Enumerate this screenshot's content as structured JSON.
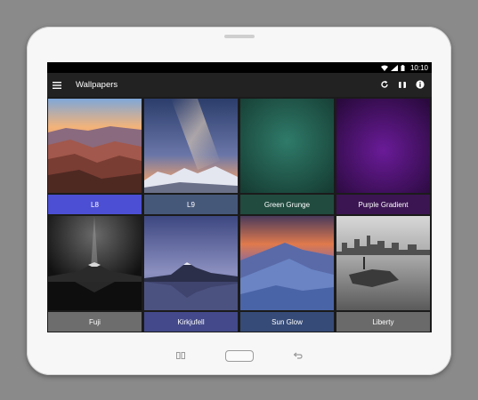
{
  "status": {
    "time": "10:10"
  },
  "appbar": {
    "title": "Wallpapers"
  },
  "wallpapers": [
    {
      "label": "L8",
      "label_color": "#4c4fd3"
    },
    {
      "label": "L9",
      "label_color": "#46587a"
    },
    {
      "label": "Green Grunge",
      "label_color": "#214b3f"
    },
    {
      "label": "Purple Gradient",
      "label_color": "#3b1552"
    },
    {
      "label": "Fuji",
      "label_color": "#6d6d6d"
    },
    {
      "label": "Kirkjufell",
      "label_color": "#43498a"
    },
    {
      "label": "Sun Glow",
      "label_color": "#364b78"
    },
    {
      "label": "Liberty",
      "label_color": "#6a6a6a"
    }
  ],
  "icons": {
    "menu": "hamburger-menu-icon",
    "refresh": "refresh-icon",
    "theme": "palette-icon",
    "info": "info-icon",
    "wifi": "wifi-icon",
    "signal": "signal-icon",
    "battery": "battery-icon",
    "recent": "recent-apps-icon",
    "back": "back-icon"
  }
}
